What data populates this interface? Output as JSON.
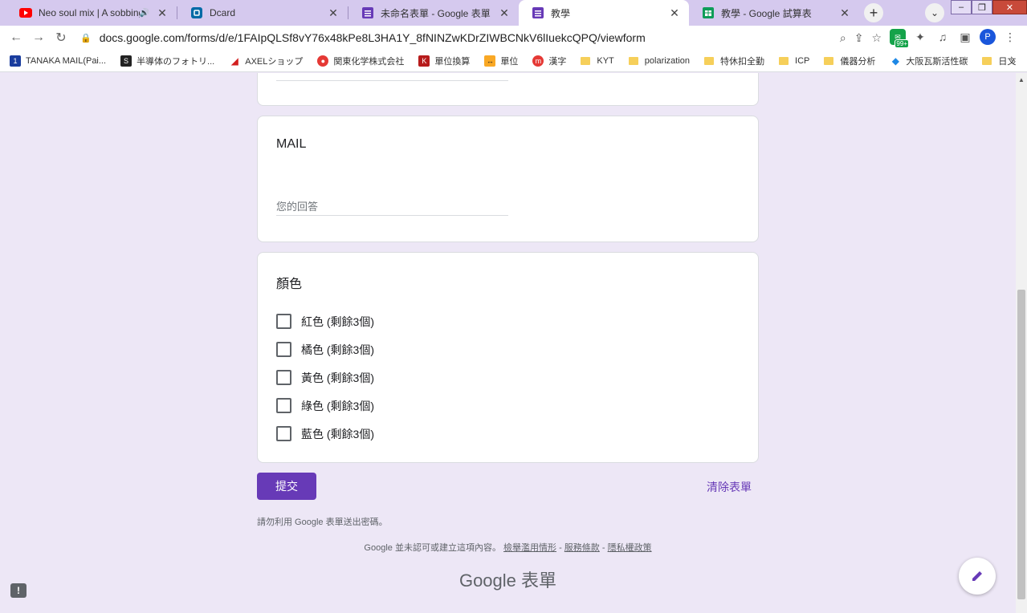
{
  "browser": {
    "tabs": [
      {
        "title": "Neo soul mix | A sobbing h",
        "icon": "youtube-icon",
        "audio": true,
        "active": false
      },
      {
        "title": "Dcard",
        "icon": "dcard-icon",
        "active": false
      },
      {
        "title": "未命名表單 - Google 表單",
        "icon": "google-forms-icon",
        "active": false
      },
      {
        "title": "教學",
        "icon": "google-forms-icon",
        "active": true
      },
      {
        "title": "教學 - Google 試算表",
        "icon": "google-sheets-icon",
        "active": false
      }
    ],
    "url": "docs.google.com/forms/d/e/1FAIpQLSf8vY76x48kPe8L3HA1Y_8fNINZwKDrZIWBCNkV6lIuekcQPQ/viewform",
    "extension_badge": "99+",
    "profile_initial": "P",
    "bookmarks": [
      {
        "label": "TANAKA MAIL(Pai...",
        "icon": "tanaka-icon"
      },
      {
        "label": "半導体のフォトリ...",
        "icon": "s-icon"
      },
      {
        "label": "AXELショップ",
        "icon": "axel-icon"
      },
      {
        "label": "関東化学株式会社",
        "icon": "kanto-icon"
      },
      {
        "label": "單位換算",
        "icon": "k-icon"
      },
      {
        "label": "單位",
        "icon": "unit-icon"
      },
      {
        "label": "漢字",
        "icon": "m-icon"
      },
      {
        "label": "KYT",
        "icon": "folder-icon"
      },
      {
        "label": "polarization",
        "icon": "folder-icon"
      },
      {
        "label": "特休扣全勤",
        "icon": "folder-icon"
      },
      {
        "label": "ICP",
        "icon": "folder-icon"
      },
      {
        "label": "儀器分析",
        "icon": "folder-icon"
      },
      {
        "label": "大阪瓦斯活性碳",
        "icon": "osaka-gas-icon"
      },
      {
        "label": "日文",
        "icon": "folder-icon"
      }
    ]
  },
  "form": {
    "mail_question": {
      "title": "MAIL",
      "placeholder": "您的回答"
    },
    "color_question": {
      "title": "顏色",
      "options": [
        "紅色 (剩餘3個)",
        "橘色 (剩餘3個)",
        "黃色 (剩餘3個)",
        "綠色 (剩餘3個)",
        "藍色 (剩餘3個)"
      ]
    },
    "submit_label": "提交",
    "clear_label": "清除表單",
    "password_warning": "請勿利用 Google 表單送出密碼。",
    "footer": {
      "text": "Google 並未認可或建立這項內容。",
      "links": [
        "檢舉濫用情形",
        "服務條款",
        "隱私權政策"
      ],
      "separator": " - "
    },
    "logo": {
      "google": "Google",
      "product": "表單"
    }
  },
  "colors": {
    "accent": "#673ab7",
    "background": "#ede7f6"
  }
}
